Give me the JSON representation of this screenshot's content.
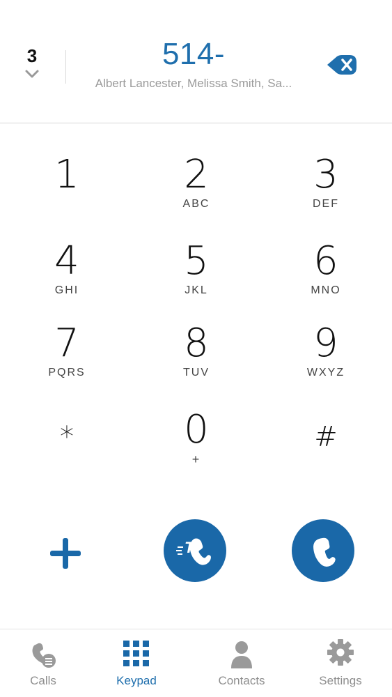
{
  "header": {
    "match_count": "3",
    "dialed_number": "514-",
    "suggestions": "Albert Lancester, Melissa Smith, Sa..."
  },
  "keypad": {
    "keys": [
      {
        "digit": "1",
        "letters": ""
      },
      {
        "digit": "2",
        "letters": "ABC"
      },
      {
        "digit": "3",
        "letters": "DEF"
      },
      {
        "digit": "4",
        "letters": "GHI"
      },
      {
        "digit": "5",
        "letters": "JKL"
      },
      {
        "digit": "6",
        "letters": "MNO"
      },
      {
        "digit": "7",
        "letters": "PQRS"
      },
      {
        "digit": "8",
        "letters": "TUV"
      },
      {
        "digit": "9",
        "letters": "WXYZ"
      },
      {
        "digit": "*",
        "letters": ""
      },
      {
        "digit": "0",
        "letters": "+"
      },
      {
        "digit": "#",
        "letters": ""
      }
    ]
  },
  "actions": {
    "add_icon": "plus-icon",
    "transfer_icon": "call-transfer-icon",
    "call_icon": "phone-icon"
  },
  "tabs": [
    {
      "label": "Calls",
      "icon": "calls-icon",
      "active": false
    },
    {
      "label": "Keypad",
      "icon": "keypad-grid-icon",
      "active": true
    },
    {
      "label": "Contacts",
      "icon": "person-icon",
      "active": false
    },
    {
      "label": "Settings",
      "icon": "gear-icon",
      "active": false
    }
  ],
  "colors": {
    "accent": "#1f6fad",
    "button_fill": "#1a68a8",
    "inactive": "#8e8e8e"
  }
}
